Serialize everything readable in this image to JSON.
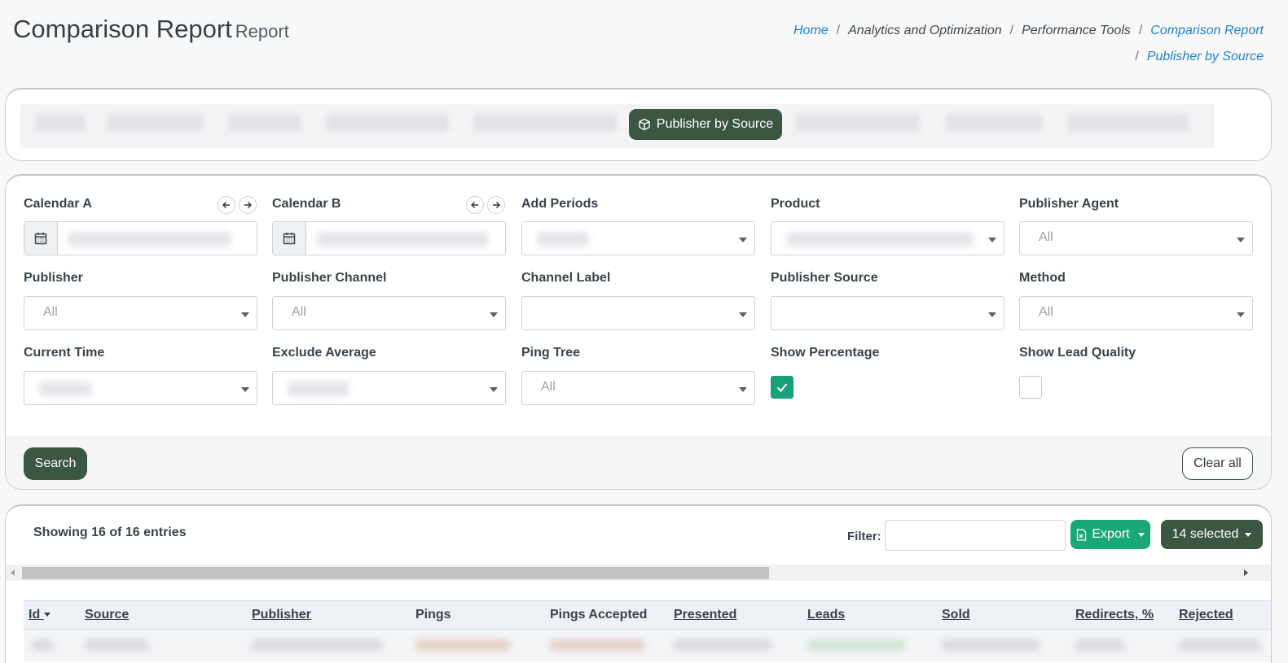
{
  "header": {
    "title": "Comparison Report",
    "subtitle": "Report",
    "breadcrumbs": [
      {
        "label": "Home",
        "link": true
      },
      {
        "label": "Analytics and Optimization",
        "link": false
      },
      {
        "label": "Performance Tools",
        "link": false
      },
      {
        "label": "Comparison Report",
        "link": true
      },
      {
        "label": "Publisher by Source",
        "link": true
      }
    ]
  },
  "tabs": {
    "active_label": "Publisher by Source"
  },
  "filters": {
    "calendar_a": {
      "label": "Calendar A"
    },
    "calendar_b": {
      "label": "Calendar B"
    },
    "add_periods": {
      "label": "Add Periods"
    },
    "product": {
      "label": "Product"
    },
    "publisher_agent": {
      "label": "Publisher Agent",
      "value": "All"
    },
    "publisher": {
      "label": "Publisher",
      "value": "All"
    },
    "publisher_channel": {
      "label": "Publisher Channel",
      "value": "All"
    },
    "channel_label": {
      "label": "Channel Label",
      "value": ""
    },
    "publisher_source": {
      "label": "Publisher Source",
      "value": ""
    },
    "method": {
      "label": "Method",
      "value": "All"
    },
    "current_time": {
      "label": "Current Time"
    },
    "exclude_average": {
      "label": "Exclude Average"
    },
    "ping_tree": {
      "label": "Ping Tree",
      "value": "All"
    },
    "show_percentage": {
      "label": "Show Percentage",
      "checked": true
    },
    "show_lead_quality": {
      "label": "Show Lead Quality",
      "checked": false
    },
    "search_label": "Search",
    "clear_label": "Clear all"
  },
  "table": {
    "showing": "Showing 16 of 16 entries",
    "filter_label": "Filter:",
    "export_label": "Export",
    "selected_label": "14 selected",
    "columns": [
      "Id",
      "Source",
      "Publisher",
      "Pings",
      "Pings Accepted",
      "Presented",
      "Leads",
      "Sold",
      "Redirects, %",
      "Rejected"
    ]
  },
  "colors": {
    "primary_dark_green": "#3b5641",
    "accent_green": "#1aa877",
    "checkbox_green": "#18a07a",
    "link_blue": "#1e7fd6"
  }
}
